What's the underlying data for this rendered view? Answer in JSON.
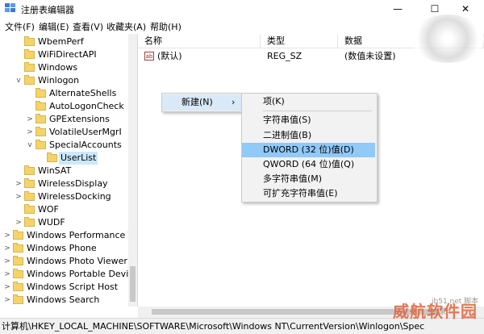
{
  "window": {
    "title": "注册表编辑器",
    "minimize": "—",
    "maximize": "☐",
    "close": "✕"
  },
  "menu": [
    "文件(F)",
    "编辑(E)",
    "查看(V)",
    "收藏夹(A)",
    "帮助(H)"
  ],
  "tree": {
    "items": [
      {
        "label": "WbemPerf",
        "expander": "",
        "selected": false
      },
      {
        "label": "WiFiDirectAPI",
        "expander": "",
        "selected": false
      },
      {
        "label": "Windows",
        "expander": "",
        "selected": false
      },
      {
        "label": "Winlogon",
        "expander": "v",
        "selected": false
      },
      {
        "label": "AlternateShells",
        "expander": "",
        "selected": false
      },
      {
        "label": "AutoLogonCheck",
        "expander": "",
        "selected": false
      },
      {
        "label": "GPExtensions",
        "expander": ">",
        "selected": false
      },
      {
        "label": "VolatileUserMgrI",
        "expander": ">",
        "selected": false
      },
      {
        "label": "SpecialAccounts",
        "expander": "v",
        "selected": false
      },
      {
        "label": "UserList",
        "expander": "",
        "selected": true
      },
      {
        "label": "WinSAT",
        "expander": "",
        "selected": false
      },
      {
        "label": "WirelessDisplay",
        "expander": ">",
        "selected": false
      },
      {
        "label": "WirelessDocking",
        "expander": ">",
        "selected": false
      },
      {
        "label": "WOF",
        "expander": "",
        "selected": false
      },
      {
        "label": "WUDF",
        "expander": ">",
        "selected": false
      },
      {
        "label": "Windows Performance Toc",
        "expander": ">",
        "selected": false
      },
      {
        "label": "Windows Phone",
        "expander": ">",
        "selected": false
      },
      {
        "label": "Windows Photo Viewer",
        "expander": ">",
        "selected": false
      },
      {
        "label": "Windows Portable Devices",
        "expander": ">",
        "selected": false
      },
      {
        "label": "Windows Script Host",
        "expander": ">",
        "selected": false
      },
      {
        "label": "Windows Search",
        "expander": ">",
        "selected": false
      }
    ]
  },
  "list": {
    "columns": [
      "名称",
      "类型",
      "数据"
    ],
    "rows": [
      {
        "icon": "ab",
        "name": "(默认)",
        "type": "REG_SZ",
        "data": "(数值未设置)"
      }
    ]
  },
  "context_menu": {
    "new_label": "新建(N)",
    "arrow": "›",
    "submenu": [
      {
        "label": "项(K)",
        "highlight": false
      },
      {
        "label": "字符串值(S)",
        "highlight": false
      },
      {
        "label": "二进制值(B)",
        "highlight": false
      },
      {
        "label": "DWORD (32 位)值(D)",
        "highlight": true
      },
      {
        "label": "QWORD (64 位)值(Q)",
        "highlight": false
      },
      {
        "label": "多字符串值(M)",
        "highlight": false
      },
      {
        "label": "可扩充字符串值(E)",
        "highlight": false
      }
    ]
  },
  "status": {
    "path": "计算机\\HKEY_LOCAL_MACHINE\\SOFTWARE\\Microsoft\\Windows NT\\CurrentVersion\\Winlogon\\Spec"
  },
  "watermark": {
    "main": "威航软件园",
    "small": "jb51.net",
    "small2": "脚本之家"
  },
  "colors": {
    "selection": "#cce8ff",
    "menu_highlight": "#91c9f7",
    "folder": "#f4d46a"
  }
}
